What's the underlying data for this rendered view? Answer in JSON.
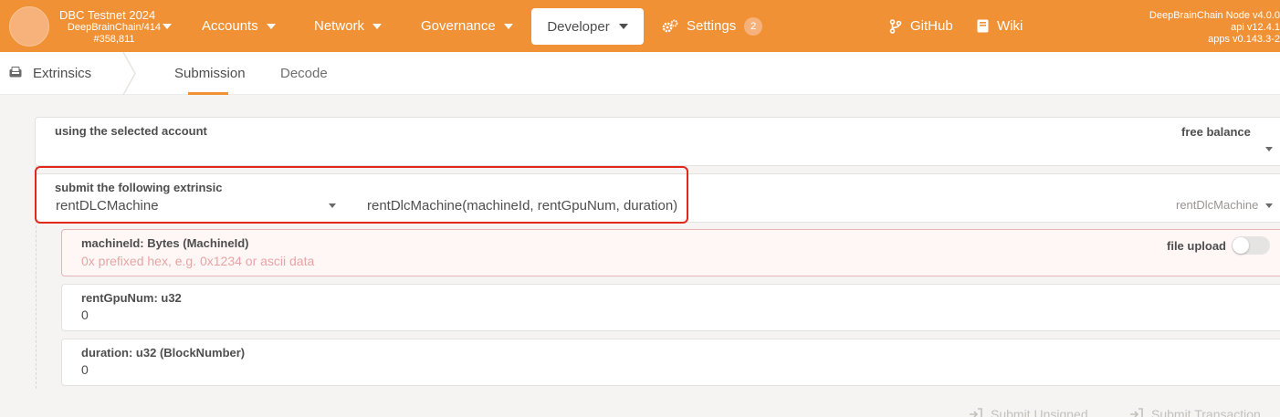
{
  "header": {
    "chain_name": "DBC Testnet 2024",
    "chain_runtime": "DeepBrainChain/414",
    "block_number": "#358,811",
    "menu": {
      "accounts": "Accounts",
      "network": "Network",
      "governance": "Governance",
      "developer": "Developer",
      "settings": "Settings",
      "settings_badge": "2",
      "github": "GitHub",
      "wiki": "Wiki"
    },
    "node_info": {
      "node": "DeepBrainChain Node v4.0.0",
      "api": "api v12.4.1",
      "apps": "apps v0.143.3-2"
    },
    "colors": {
      "brand": "#f19135"
    }
  },
  "subnav": {
    "section": "Extrinsics",
    "tabs": {
      "submission": "Submission",
      "decode": "Decode"
    }
  },
  "form": {
    "account_label": "using the selected account",
    "free_balance_label": "free balance",
    "extrinsic_label": "submit the following extrinsic",
    "module_value": "rentDLCMachine",
    "call_signature": "rentDlcMachine(machineId, rentGpuNum, duration)",
    "call_value": "rentDlcMachine",
    "params": {
      "machine_id": {
        "label": "machineId: Bytes (MachineId)",
        "placeholder": "0x prefixed hex, e.g. 0x1234 or ascii data",
        "file_upload_label": "file upload"
      },
      "rent_gpu_num": {
        "label": "rentGpuNum: u32",
        "value": "0"
      },
      "duration": {
        "label": "duration: u32 (BlockNumber)",
        "value": "0"
      }
    },
    "actions": {
      "submit_unsigned": "Submit Unsigned",
      "submit_transaction": "Submit Transaction"
    },
    "colors": {
      "error_border": "#e3281b",
      "invalid_bg": "#fff6f6"
    }
  }
}
